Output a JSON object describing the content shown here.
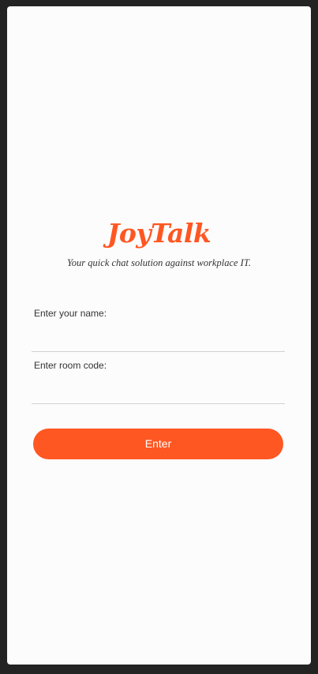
{
  "app": {
    "logo_text": "JoyTalk",
    "tagline": "Your quick chat solution against workplace IT."
  },
  "form": {
    "name_label": "Enter your name:",
    "name_value": "",
    "room_label": "Enter room code:",
    "room_value": "",
    "submit_label": "Enter"
  },
  "colors": {
    "accent": "#ff5722",
    "page_background": "#232323",
    "card_background": "#fdfcfd",
    "divider": "#d2d2d2"
  }
}
